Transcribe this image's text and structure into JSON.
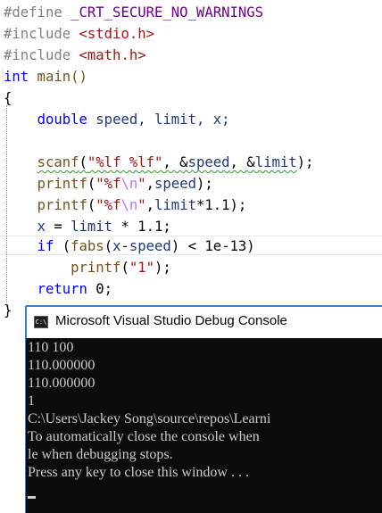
{
  "editor": {
    "lines": [
      {
        "seg": [
          "#define ",
          "_CRT_SECURE_NO_WARNINGS"
        ]
      },
      {
        "seg": [
          "#include ",
          "<stdio.h>"
        ]
      },
      {
        "seg": [
          "#include ",
          "<math.h>"
        ]
      },
      {
        "seg": [
          "int",
          " main()"
        ]
      },
      {
        "seg": [
          "{"
        ]
      },
      {
        "seg": [
          "    ",
          "double",
          " speed, limit, x;"
        ]
      },
      {
        "seg": [
          ""
        ]
      },
      {
        "seg": [
          "    ",
          "scanf",
          "(",
          "\"%lf %lf\"",
          ", &",
          "speed",
          ", &",
          "limit",
          ");"
        ]
      },
      {
        "seg": [
          "    ",
          "printf",
          "(",
          "\"%f",
          "\\n",
          "\"",
          ",",
          "speed",
          ");"
        ]
      },
      {
        "seg": [
          "    ",
          "printf",
          "(",
          "\"%f",
          "\\n",
          "\"",
          ",",
          "limit",
          "*1.1);"
        ]
      },
      {
        "seg": [
          "    ",
          "x",
          " = ",
          "limit",
          " * 1.1;"
        ]
      },
      {
        "seg": [
          "    ",
          "if",
          " (",
          "fabs",
          "(",
          "x",
          "-",
          "speed",
          ") < 1e-13)"
        ]
      },
      {
        "seg": [
          "        ",
          "printf",
          "(",
          "\"1\"",
          ");"
        ]
      },
      {
        "seg": [
          "    ",
          "return",
          " 0;"
        ]
      },
      {
        "seg": [
          "}"
        ]
      }
    ]
  },
  "console": {
    "title": "Microsoft Visual Studio Debug Console",
    "icon_label": "C:\\",
    "icon": "console-window-icon",
    "lines": [
      "110 100",
      "110.000000",
      "110.000000",
      "1",
      "C:\\Users\\Jackey Song\\source\\repos\\Learni",
      "To automatically close the console when",
      "le when debugging stops.",
      "Press any key to close this window . . ."
    ]
  },
  "colors": {
    "keyword": "#0000ff",
    "preprocessor": "#808080",
    "macro": "#6f008a",
    "string": "#a31515",
    "escape": "#b776fb",
    "identifier": "#1f377f",
    "function": "#74531f",
    "console_bg": "#0c0c0c",
    "console_fg": "#cccccc"
  }
}
